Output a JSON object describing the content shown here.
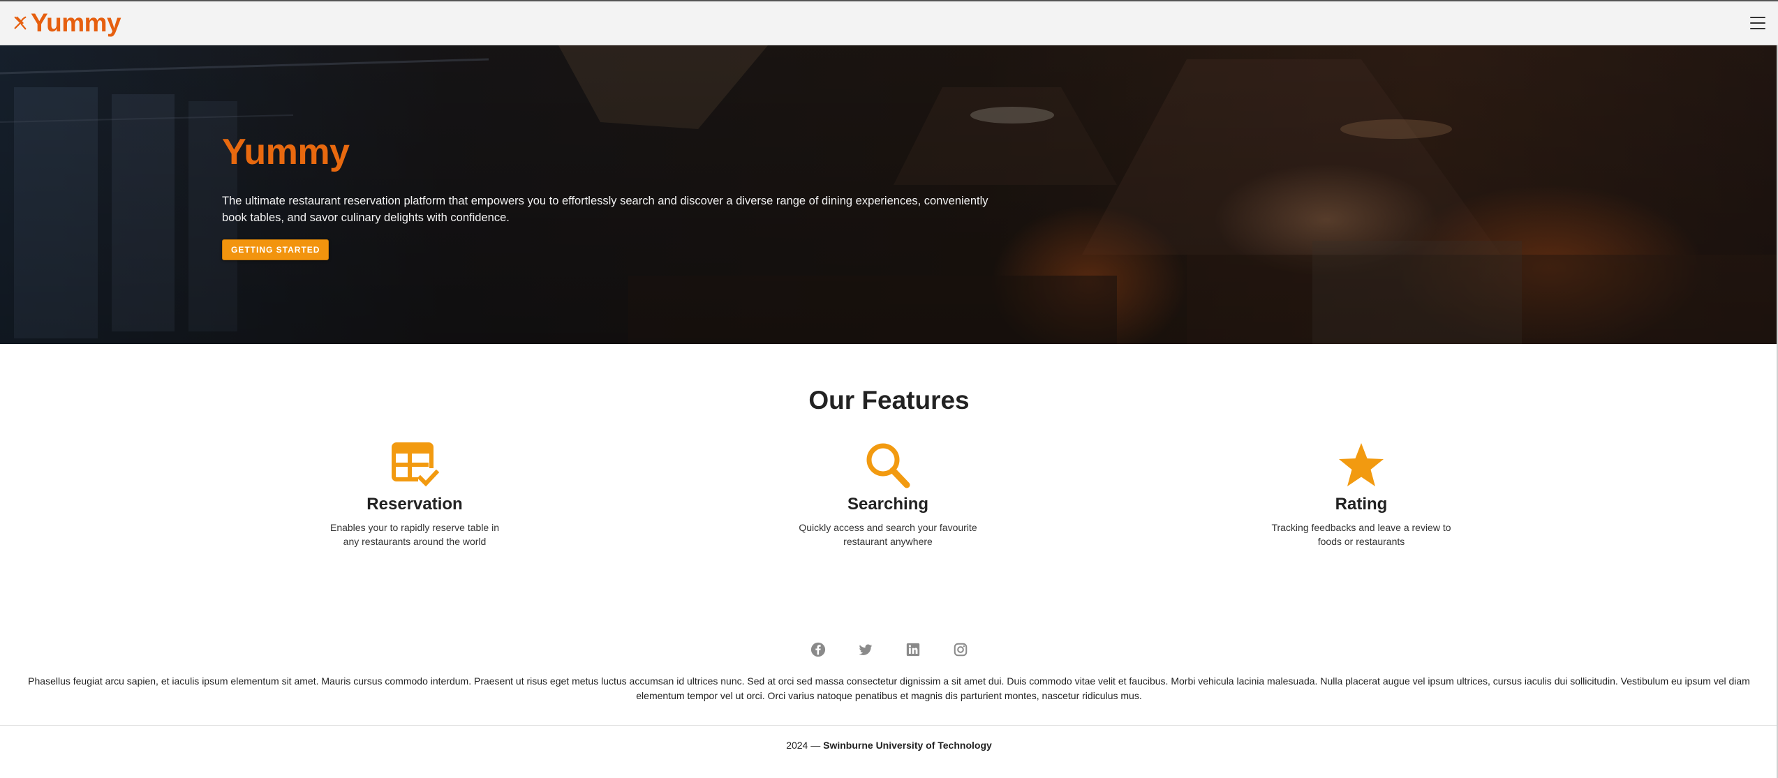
{
  "header": {
    "brand": "Yummy",
    "brand_icon": "fork-knife-icon",
    "menu_icon": "hamburger-menu-icon"
  },
  "hero": {
    "title": "Yummy",
    "description": "The ultimate restaurant reservation platform that empowers you to effortlessly search and discover a diverse range of dining experiences, conveniently book tables, and savor culinary delights with confidence.",
    "cta_label": "GETTING STARTED"
  },
  "features": {
    "title": "Our Features",
    "items": [
      {
        "icon": "table-check-icon",
        "title": "Reservation",
        "description": "Enables your to rapidly reserve table in any restaurants around the world"
      },
      {
        "icon": "search-icon",
        "title": "Searching",
        "description": "Quickly access and search your favourite restaurant anywhere"
      },
      {
        "icon": "star-icon",
        "title": "Rating",
        "description": "Tracking feedbacks and leave a review to foods or restaurants"
      }
    ]
  },
  "footer": {
    "social": [
      "facebook-icon",
      "twitter-icon",
      "linkedin-icon",
      "instagram-icon"
    ],
    "text": "Phasellus feugiat arcu sapien, et iaculis ipsum elementum sit amet. Mauris cursus commodo interdum. Praesent ut risus eget metus luctus accumsan id ultrices nunc. Sed at orci sed massa consectetur dignissim a sit amet dui. Duis commodo vitae velit et faucibus. Morbi vehicula lacinia malesuada. Nulla placerat augue vel ipsum ultrices, cursus iaculis dui sollicitudin. Vestibulum eu ipsum vel diam elementum tempor vel ut orci. Orci varius natoque penatibus et magnis dis parturient montes, nascetur ridiculus mus.",
    "year": "2024 —",
    "org": "Swinburne University of Technology"
  },
  "colors": {
    "brand": "#e65f0f",
    "accent": "#f2940e",
    "icon": "#f29a10",
    "social": "#8a8a8a"
  }
}
